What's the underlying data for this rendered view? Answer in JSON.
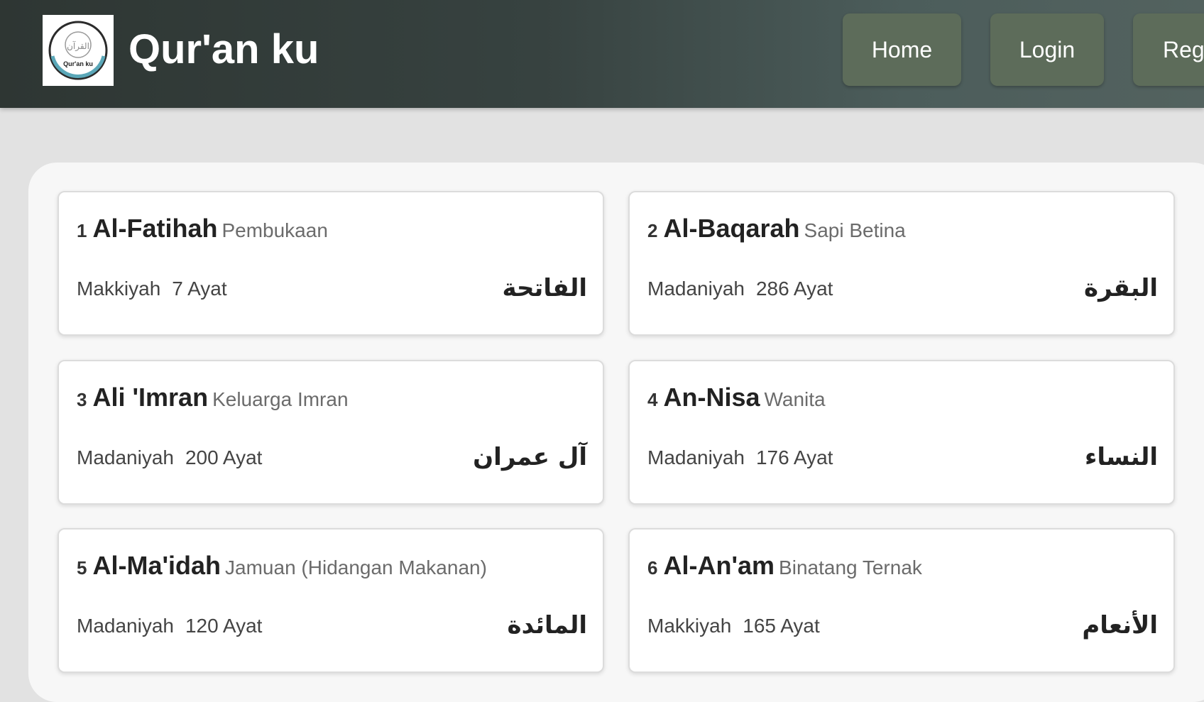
{
  "header": {
    "brand": "Qur'an ku",
    "logo_text": "Qur'an ku",
    "logo_arabic": "القرآن",
    "nav": [
      {
        "label": "Home"
      },
      {
        "label": "Login"
      },
      {
        "label": "Reg"
      }
    ]
  },
  "surahs": [
    {
      "number": "1",
      "name": "Al-Fatihah",
      "meaning": "Pembukaan",
      "type": "Makkiyah",
      "ayat": "7 Ayat",
      "arabic": "الفاتحة"
    },
    {
      "number": "2",
      "name": "Al-Baqarah",
      "meaning": "Sapi Betina",
      "type": "Madaniyah",
      "ayat": "286 Ayat",
      "arabic": "البقرة"
    },
    {
      "number": "3",
      "name": "Ali 'Imran",
      "meaning": "Keluarga Imran",
      "type": "Madaniyah",
      "ayat": "200 Ayat",
      "arabic": "آل عمران"
    },
    {
      "number": "4",
      "name": "An-Nisa",
      "meaning": "Wanita",
      "type": "Madaniyah",
      "ayat": "176 Ayat",
      "arabic": "النساء"
    },
    {
      "number": "5",
      "name": "Al-Ma'idah",
      "meaning": "Jamuan (Hidangan Makanan)",
      "type": "Madaniyah",
      "ayat": "120 Ayat",
      "arabic": "المائدة"
    },
    {
      "number": "6",
      "name": "Al-An'am",
      "meaning": "Binatang Ternak",
      "type": "Makkiyah",
      "ayat": "165 Ayat",
      "arabic": "الأنعام"
    }
  ],
  "colors": {
    "header_dark": "#2e3633",
    "header_light": "#53625f",
    "nav_button": "#5d6c5a",
    "page_bg": "#e2e2e2",
    "panel_bg": "#f7f7f7",
    "card_bg": "#ffffff"
  }
}
